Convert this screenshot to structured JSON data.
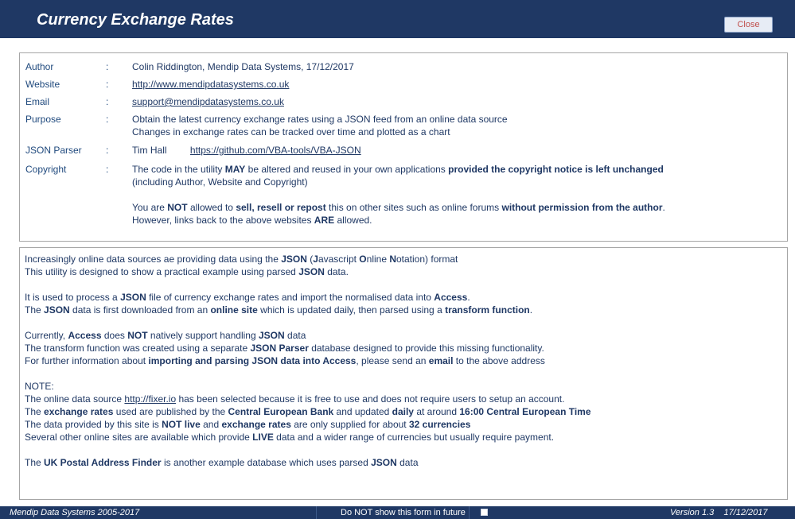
{
  "window": {
    "title": "Currency Exchange Rates",
    "close_label": "Close"
  },
  "info": {
    "author": {
      "label": "Author",
      "value": "Colin Riddington, Mendip Data Systems, 17/12/2017"
    },
    "website": {
      "label": "Website",
      "value": "http://www.mendipdatasystems.co.uk"
    },
    "email": {
      "label": "Email",
      "value": "support@mendipdatasystems.co.uk"
    },
    "purpose": {
      "label": "Purpose",
      "line1": "Obtain the latest currency exchange rates using a JSON feed from an online data source",
      "line2": "Changes in exchange rates can be tracked over time and plotted as a chart"
    },
    "json_parser": {
      "label": "JSON Parser",
      "name": "Tim Hall",
      "link": "https://github.com/VBA-tools/VBA-JSON"
    },
    "copyright": {
      "label": "Copyright",
      "p1a": "The code in the utility ",
      "p1b": "MAY",
      "p1c": " be altered and reused in your own applications ",
      "p1d": "provided the copyright notice is left unchanged",
      "p1e": "(including Author, Website and Copyright)",
      "p2a": "You are ",
      "p2b": "NOT",
      "p2c": " allowed to ",
      "p2d": "sell, resell or repost",
      "p2e": " this on other sites such as online forums ",
      "p2f": "without permission from the author",
      "p2g": ".",
      "p3a": "However, links back to the above websites ",
      "p3b": "ARE",
      "p3c": " allowed."
    },
    "colon": ":"
  },
  "desc": {
    "l1a": "Increasingly online data sources ae providing data using the ",
    "l1b": "JSON",
    "l1c": " (",
    "l1d": "J",
    "l1e": "avascript ",
    "l1f": "O",
    "l1g": "nline ",
    "l1h": "N",
    "l1i": "otation) format",
    "l2a": "This utility is designed to show a practical example using parsed ",
    "l2b": "JSON",
    "l2c": " data.",
    "l3a": "It is used to process a ",
    "l3b": "JSON",
    "l3c": " file of currency exchange rates and import the normalised data into ",
    "l3d": "Access",
    "l3e": ".",
    "l4a": "The ",
    "l4b": "JSON",
    "l4c": " data is first downloaded from an ",
    "l4d": "online site",
    "l4e": " which is updated daily, then parsed using a ",
    "l4f": "transform function",
    "l4g": ".",
    "l5a": "Currently, ",
    "l5b": "Access",
    "l5c": " does ",
    "l5d": "NOT",
    "l5e": " natively support handling ",
    "l5f": "JSON",
    "l5g": " data",
    "l6a": "The transform function was created using a separate ",
    "l6b": "JSON Parser",
    "l6c": " database designed to provide this missing functionality.",
    "l7a": " For further information about ",
    "l7b": "importing and parsing JSON data into Access",
    "l7c": ", please send an ",
    "l7d": "email",
    "l7e": " to the above address",
    "l8": "NOTE:",
    "l9a": "The online data source ",
    "l9b": "http://fixer.io",
    "l9c": " has been selected because it is free to use and does not require users to setup an account.",
    "l10a": "The ",
    "l10b": "exchange rates",
    "l10c": " used are published by the ",
    "l10d": "Central European Bank",
    "l10e": " and updated ",
    "l10f": "daily",
    "l10g": " at around ",
    "l10h": "16:00 Central European Time",
    "l11a": "The data provided by this site is ",
    "l11b": "NOT live",
    "l11c": " and ",
    "l11d": "exchange rates",
    "l11e": " are only supplied for about ",
    "l11f": "32 currencies",
    "l12a": " Several other online sites are available which provide ",
    "l12b": "LIVE",
    "l12c": " data and a wider range of currencies but usually require payment.",
    "l13a": "The ",
    "l13b": "UK Postal Address Finder",
    "l13c": " is another example database which uses parsed ",
    "l13d": "JSON",
    "l13e": " data"
  },
  "footer": {
    "left": "Mendip Data Systems 2005-2017",
    "mid": "Do NOT show this form in future",
    "checkbox_checked": false,
    "right": "Version 1.3    17/12/2017"
  }
}
